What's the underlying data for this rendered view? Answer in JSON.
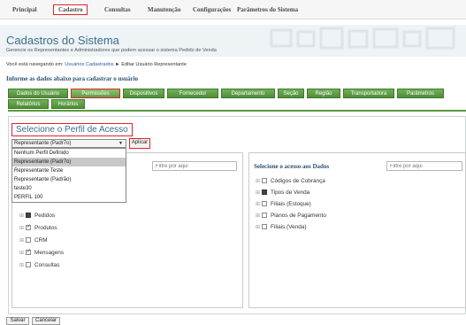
{
  "top_menu": [
    {
      "label": "Principal"
    },
    {
      "label": "Cadastro",
      "active": true
    },
    {
      "label": "Consultas"
    },
    {
      "label": "Manutenção"
    },
    {
      "label": "Configurações"
    },
    {
      "label": "Parâmetros do Sistema"
    }
  ],
  "page": {
    "title": "Cadastros do Sistema",
    "subtitle": "Gerencie os Representantes e Administradores que podem acessar o sistema Pedido de Venda",
    "breadcrumb_prefix": "Você está navegando em:",
    "breadcrumb_link": "Usuários Cadastrados",
    "breadcrumb_current": "► Editar Usuário Representante",
    "section_title": "Informe as dados abaixo para cadastrar o usuário"
  },
  "tabs_row1": [
    "Dados do Usuário",
    "Permissões",
    "Dispositivos",
    "Fornecedor",
    "Departamento",
    "Seção",
    "Região",
    "Transportadora",
    "Parâmetros"
  ],
  "tabs_row2": [
    "Relatórios",
    "Horários"
  ],
  "active_tab": "Permissões",
  "perfil": {
    "title": "Selecione o Perfil de Acesso",
    "selected": "Representante (Padr7o)",
    "apply_label": "Aplicar",
    "options": [
      "Nenhum Perfil Definido",
      "Representante (Padr7o)",
      "Representante Teste",
      "Representante (Padrão)",
      "teste30",
      "PERFIL 100"
    ]
  },
  "left_panel": {
    "filter_placeholder": "Filtre por aqui",
    "items": [
      {
        "label": "Pedidos",
        "state": "partial"
      },
      {
        "label": "Produtos",
        "state": "checked"
      },
      {
        "label": "CRM",
        "state": "unchecked"
      },
      {
        "label": "Mensagens",
        "state": "checked"
      },
      {
        "label": "Consultas",
        "state": "unchecked"
      }
    ]
  },
  "right_panel": {
    "title": "Selecione o acesso aos Dados",
    "filter_placeholder": "Filtre por aqui",
    "items": [
      {
        "label": "Códigos de Cobrança",
        "state": "unchecked"
      },
      {
        "label": "Tipos de Venda",
        "state": "partial"
      },
      {
        "label": "Filiais (Estoque)",
        "state": "unchecked"
      },
      {
        "label": "Planos de Pagamento",
        "state": "unchecked"
      },
      {
        "label": "Filiais (Venda)",
        "state": "unchecked"
      }
    ]
  },
  "buttons": {
    "save": "Salvar",
    "cancel": "Cancelar"
  },
  "colors": {
    "accent_green": "#5b9a3f",
    "highlight_red": "#d9262c",
    "title_blue": "#3c6e8c"
  }
}
